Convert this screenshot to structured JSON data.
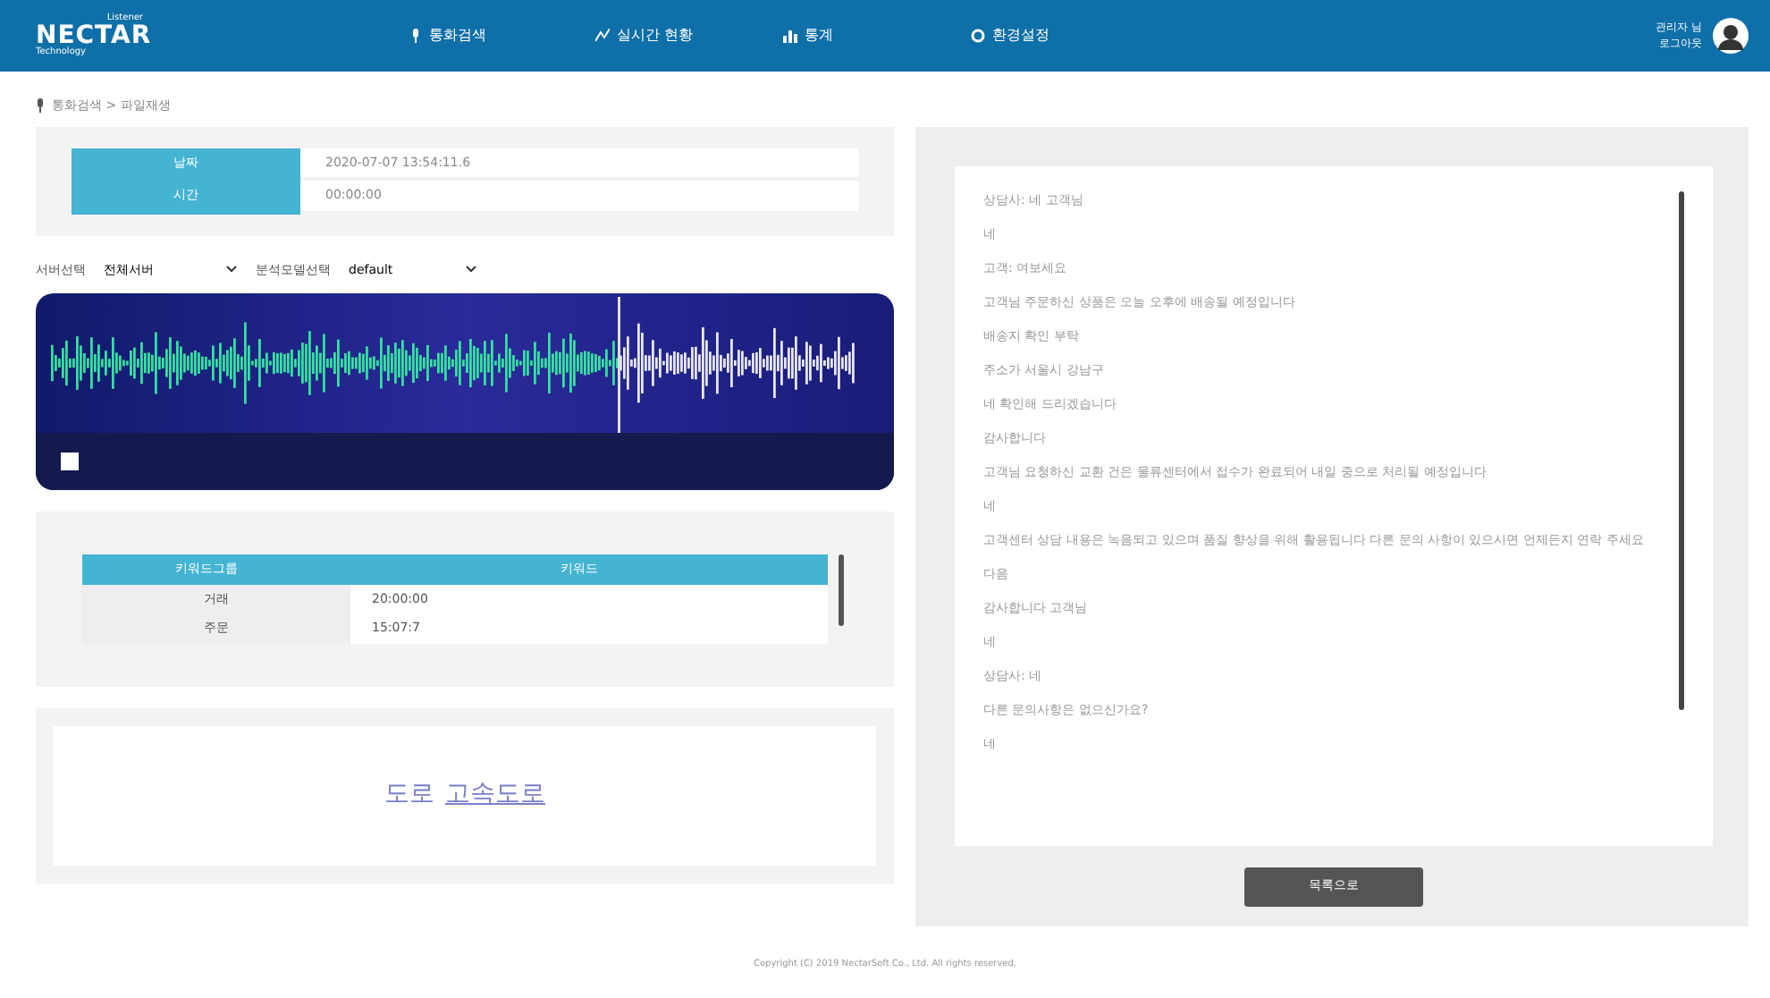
{
  "brand": {
    "name": "NECTAR",
    "top": "Listener",
    "sub": "Technology"
  },
  "nav": [
    {
      "label": "통화검색",
      "selected": false
    },
    {
      "label": "실시간 현황",
      "selected": false
    },
    {
      "label": "통계",
      "selected": false
    },
    {
      "label": "환경설정",
      "selected": false
    }
  ],
  "user": {
    "name": "관리자 님",
    "action": "로그아웃"
  },
  "breadcrumb": "통화검색 > 파일재생",
  "info": [
    {
      "label": "날짜",
      "value": "2020-07-07 13:54:11.6"
    },
    {
      "label": "시간",
      "value": "00:00:00"
    }
  ],
  "filters": [
    {
      "label": "서버선택",
      "value": "전체서버"
    },
    {
      "label": "분석모델선택",
      "value": "default"
    }
  ],
  "player": {
    "playback": {
      "level": 0.68
    }
  },
  "keyword_table": {
    "columns": [
      "키워드그룹",
      "키워드"
    ],
    "rows": [
      [
        "거래",
        "20:00:00"
      ],
      [
        "주문",
        "15:07:7"
      ]
    ]
  },
  "keywords": [
    "도로",
    "고속도로"
  ],
  "transcript": [
    "상담사: 네 고객님",
    "네",
    "고객: 여보세요",
    "고객님 주문하신 상품은 오늘 오후에 배송될 예정입니다",
    "배송지 확인 부탁",
    "주소가 서울시 강남구",
    "네 확인해 드리겠습니다",
    "감사합니다",
    "고객님 요청하신 교환 건은 물류센터에서 접수가 완료되어 내일 중으로 처리될 예정입니다",
    "네",
    "고객센터 상담 내용은 녹음되고 있으며 품질 향상을 위해 활용됩니다 다른 문의 사항이 있으시면 언제든지 연락 주세요",
    "다음",
    "감사합니다 고객님",
    "네",
    "상담사: 네",
    "다른 문의사항은 없으신가요?",
    "네"
  ],
  "button": "목록으로",
  "footer": "Copyright (C) 2019 NectarSoft Co., Ltd. All rights reserved."
}
